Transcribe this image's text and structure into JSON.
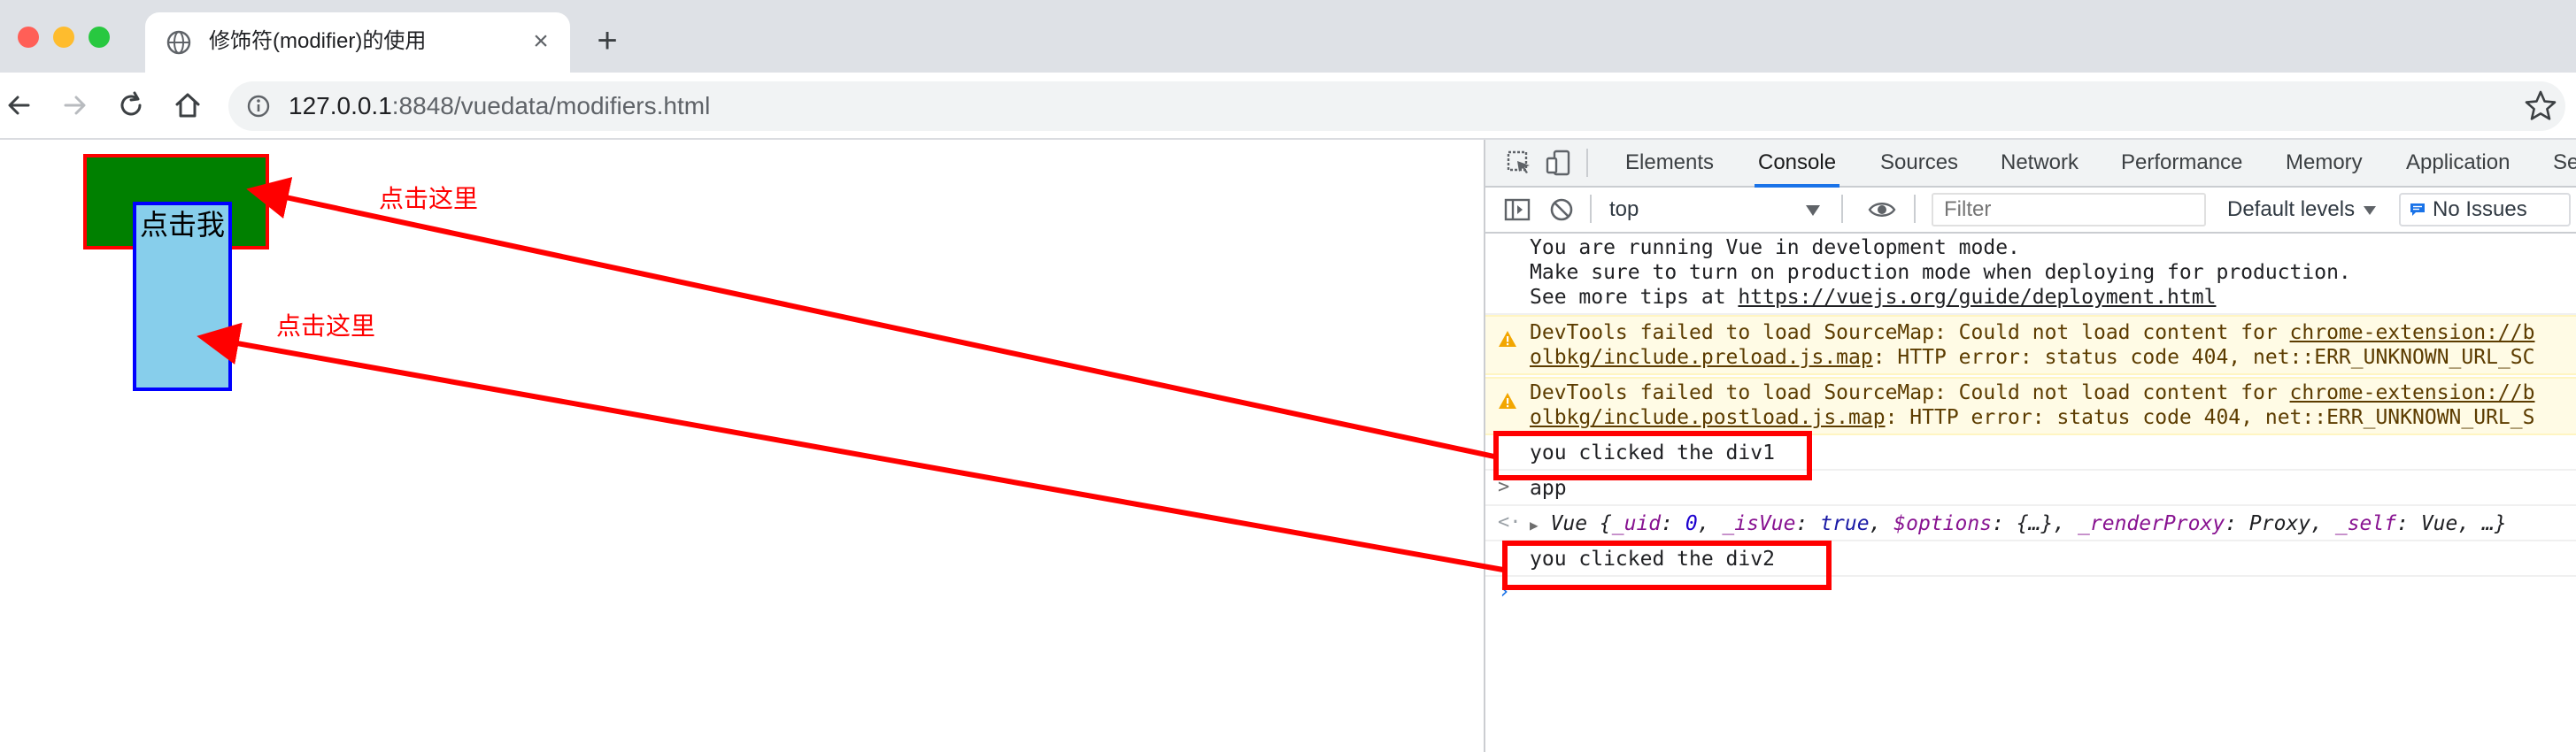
{
  "browser": {
    "tab_title": "修饰符(modifier)的使用",
    "tab_close_label": "×",
    "new_tab_label": "+",
    "url_host": "127.0.0.1",
    "url_rest": ":8848/vuedata/modifiers.html"
  },
  "page": {
    "div2_text": "点击我",
    "annotation_1": "点击这里",
    "annotation_2": "点击这里",
    "annotation_color": "#ff0000"
  },
  "devtools": {
    "tabs": [
      "Elements",
      "Console",
      "Sources",
      "Network",
      "Performance",
      "Memory",
      "Application",
      "Se"
    ],
    "active_tab": "Console",
    "context": "top",
    "filter_placeholder": "Filter",
    "levels_label": "Default levels",
    "issues_label": "No Issues",
    "console": {
      "vue_info": [
        "You are running Vue in development mode.",
        "Make sure to turn on production mode when deploying for production.",
        "See more tips at "
      ],
      "vue_info_link": "https://vuejs.org/guide/deployment.html",
      "warn1_a": "DevTools failed to load SourceMap: Could not load content for ",
      "warn1_a_link": "chrome-extension://b",
      "warn1_b_link": "olbkg/include.preload.js.map",
      "warn1_b": ": HTTP error: status code 404, net::ERR_UNKNOWN_URL_SC",
      "warn2_a": "DevTools failed to load SourceMap: Could not load content for ",
      "warn2_a_link": "chrome-extension://b",
      "warn2_b_link": "olbkg/include.postload.js.map",
      "warn2_b": ": HTTP error: status code 404, net::ERR_UNKNOWN_URL_S",
      "log1": "you clicked the div1",
      "input_expr": "app",
      "result_prefix": "Vue {",
      "result_k1": "_uid",
      "result_v1": "0",
      "result_k2": "_isVue",
      "result_v2": "true",
      "result_k3": "$options",
      "result_v3": "{…}",
      "result_k4": "_renderProxy",
      "result_v4": "Proxy",
      "result_k5": "_self",
      "result_v5": "Vue",
      "result_suffix": ", …}",
      "log2": "you clicked the div2"
    }
  }
}
